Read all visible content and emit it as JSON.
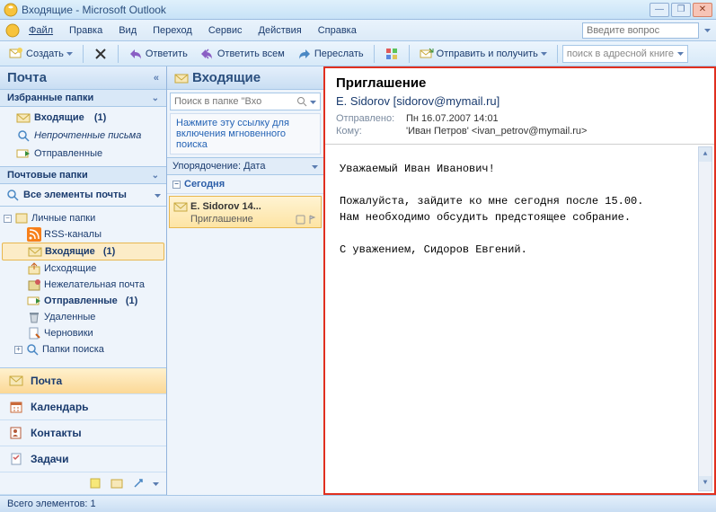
{
  "window": {
    "title": "Входящие - Microsoft Outlook"
  },
  "menu": {
    "file": "Файл",
    "edit": "Правка",
    "view": "Вид",
    "goto": "Переход",
    "tools": "Сервис",
    "actions": "Действия",
    "help": "Справка",
    "help_placeholder": "Введите вопрос"
  },
  "toolbar": {
    "new": "Создать",
    "reply": "Ответить",
    "reply_all": "Ответить всем",
    "forward": "Переслать",
    "send_receive": "Отправить и получить",
    "search_placeholder": "поиск в адресной книге"
  },
  "nav": {
    "header": "Почта",
    "fav_header": "Избранные папки",
    "fav": {
      "inbox": "Входящие",
      "inbox_count": "(1)",
      "unread": "Непрочтенные письма",
      "sent": "Отправленные"
    },
    "mail_header": "Почтовые папки",
    "all_items": "Все элементы почты",
    "tree": {
      "personal": "Личные папки",
      "rss": "RSS-каналы",
      "inbox": "Входящие",
      "inbox_count": "(1)",
      "outbox": "Исходящие",
      "junk": "Нежелательная почта",
      "sent": "Отправленные",
      "sent_count": "(1)",
      "deleted": "Удаленные",
      "drafts": "Черновики",
      "search": "Папки поиска"
    },
    "bottom": {
      "mail": "Почта",
      "calendar": "Календарь",
      "contacts": "Контакты",
      "tasks": "Задачи"
    }
  },
  "list": {
    "header": "Входящие",
    "search_placeholder": "Поиск в папке \"Вхо",
    "instant_link": "Нажмите эту ссылку для включения мгновенного поиска",
    "sort_label": "Упорядочение: Дата",
    "group_today": "Сегодня",
    "msg": {
      "icon": "mail",
      "from_time": "E. Sidorov 14...",
      "subject": "Приглашение"
    }
  },
  "reading": {
    "subject": "Приглашение",
    "from": "E. Sidorov [sidorov@mymail.ru]",
    "sent_lbl": "Отправлено:",
    "sent_val": "Пн 16.07.2007 14:01",
    "to_lbl": "Кому:",
    "to_val": "'Иван Петров' <ivan_petrov@mymail.ru>",
    "body_l1": "Уважаемый Иван Иванович!",
    "body_l2": "Пожалуйста, зайдите ко мне сегодня после 15.00.",
    "body_l3": "Нам необходимо обсудить предстоящее собрание.",
    "body_l4": "С уважением, Сидоров Евгений."
  },
  "status": {
    "text": "Всего элементов: 1"
  }
}
